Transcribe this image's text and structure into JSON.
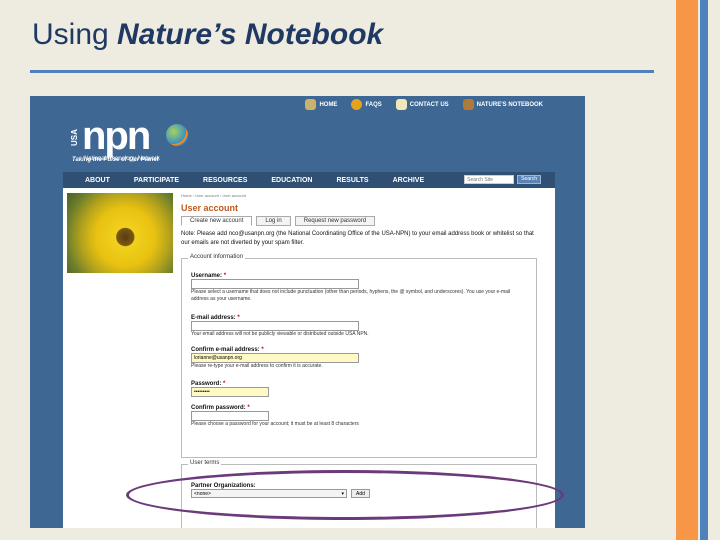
{
  "slide": {
    "title_plain": "Using ",
    "title_emph": "Nature’s Notebook"
  },
  "topnav": [
    {
      "label": "HOME",
      "icon": "home-icon"
    },
    {
      "label": "FAQS",
      "icon": "faq-icon"
    },
    {
      "label": "CONTACT US",
      "icon": "mail-icon"
    },
    {
      "label": "NATURE'S NOTEBOOK",
      "icon": "book-icon"
    }
  ],
  "logo": {
    "usa": "USA",
    "npn": "npn",
    "network": "National Phenology Network",
    "tagline": "Taking the Pulse of Our Planet"
  },
  "mainnav": [
    "ABOUT",
    "PARTICIPATE",
    "RESOURCES",
    "EDUCATION",
    "RESULTS",
    "ARCHIVE"
  ],
  "search": {
    "placeholder": "Search Site",
    "button": "Search"
  },
  "breadcrumb": "Home › User account › User account",
  "heading": "User account",
  "tabs": [
    "Create new account",
    "Log in",
    "Request new password"
  ],
  "note": "Note: Please add nco@usanpn.org (the National Coordinating Office of the USA-NPN) to your email address book or whitelist so that our emails are not diverted by your spam filter.",
  "account_info": {
    "legend": "Account information",
    "username_label": "Username:",
    "username_desc": "Please select a username that does not include punctuation (other than periods, hyphens, the @ symbol, and underscores). You use your e-mail address as your username.",
    "email_label": "E-mail address:",
    "email_desc": "Your email address will not be publicly viewable or distributed outside USA NPN.",
    "confirm_email_label": "Confirm e-mail address:",
    "confirm_email_value": "lorianne@usanpn.org",
    "confirm_email_desc": "Please re-type your e-mail address to confirm it is accurate.",
    "password_label": "Password:",
    "password_value": "•••••••••",
    "confirm_password_label": "Confirm password:",
    "password_desc": "Please choose a password for your account; it must be at least 8 characters"
  },
  "user_terms": {
    "legend": "User terms",
    "partner_label": "Partner Organizations:",
    "partner_value": "<none>",
    "add_label": "Add"
  },
  "required_mark": "*"
}
